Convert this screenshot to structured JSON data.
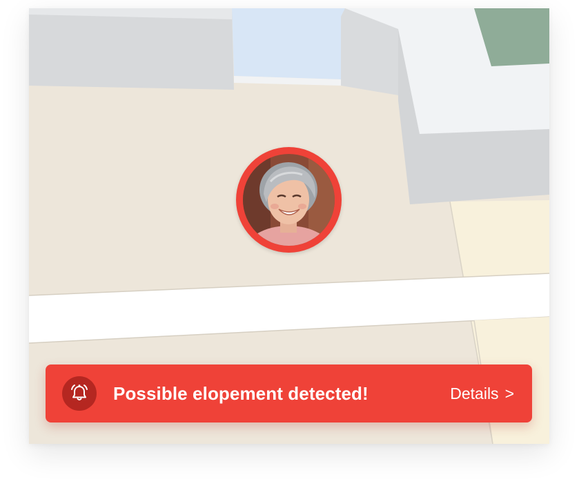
{
  "alert": {
    "message": "Possible elopement detected!",
    "details_label": "Details",
    "details_chevron": ">",
    "icon": "ringing-bell-icon",
    "background_color": "#ef4238"
  },
  "resident_marker": {
    "status_color": "#ef4238",
    "icon": "resident-avatar"
  },
  "map": {
    "floor_color": "#ede6da",
    "corridor_color": "#ffffff",
    "wall_color": "#d6d8da",
    "room_accent_blue": "#d8e6f6",
    "room_accent_green": "#8fac98",
    "room_accent_yellow": "#f8f1dc"
  }
}
